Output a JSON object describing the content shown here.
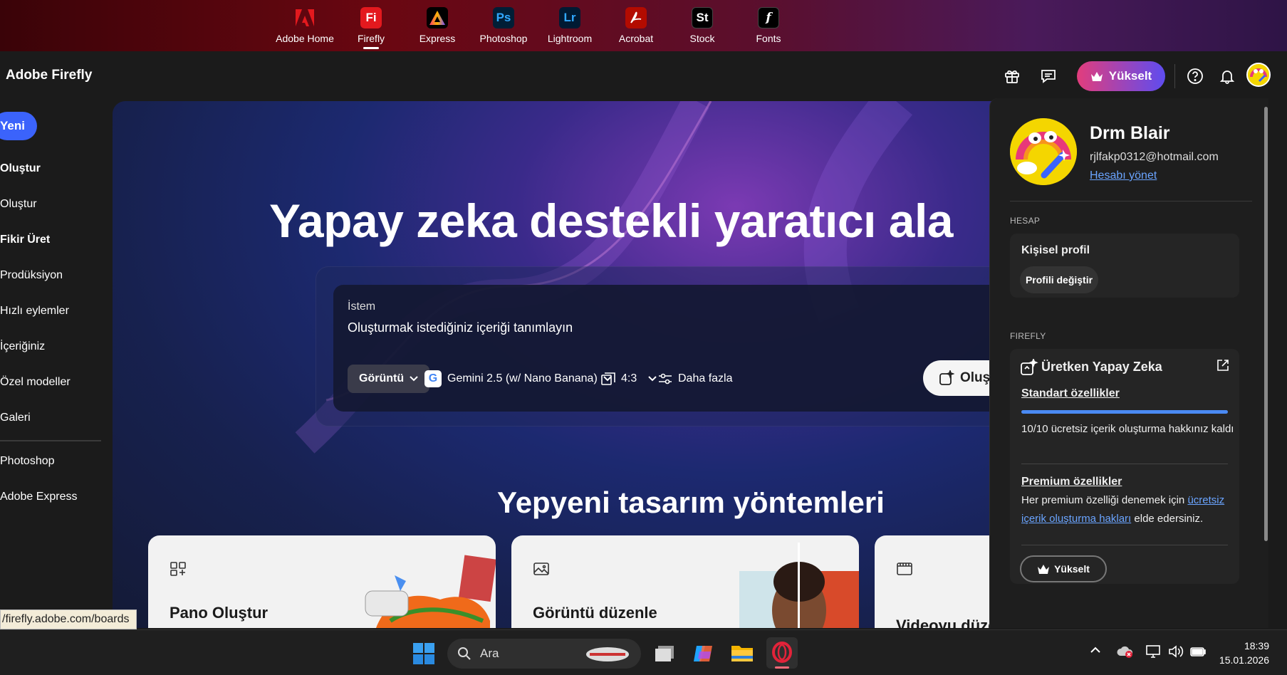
{
  "apps": [
    {
      "label": "Adobe Home",
      "glyph": "",
      "color": "#e3191e"
    },
    {
      "label": "Firefly",
      "glyph": "Fi",
      "color": "#e3191e"
    },
    {
      "label": "Express",
      "glyph": "A",
      "color": "#000000"
    },
    {
      "label": "Photoshop",
      "glyph": "Ps",
      "color": "#001e36"
    },
    {
      "label": "Lightroom",
      "glyph": "Lr",
      "color": "#001a33"
    },
    {
      "label": "Acrobat",
      "glyph": "",
      "color": "#b30b00"
    },
    {
      "label": "Stock",
      "glyph": "St",
      "color": "#000000"
    },
    {
      "label": "Fonts",
      "glyph": "f",
      "color": "#000000"
    }
  ],
  "header": {
    "brand": "Adobe Firefly",
    "upgrade_label": "Yükselt"
  },
  "sidebar": {
    "new_label": "Yeni",
    "items": [
      "Oluştur",
      "Oluştur",
      "Fikir Üret",
      "Prodüksiyon",
      "Hızlı eylemler",
      "İçeriğiniz",
      "Özel modeller",
      "Galeri",
      "Photoshop",
      "Adobe Express"
    ]
  },
  "hero": {
    "title": "Yapay zeka destekli yaratıcı ala",
    "prompt_label": "İstem",
    "prompt_placeholder": "Oluşturmak istediğiniz içeriği tanımlayın",
    "type_label": "Görüntü",
    "model_label": "Gemini 2.5 (w/ Nano Banana)",
    "ratio_label": "4:3",
    "more_label": "Daha fazla",
    "generate_label": "Oluş",
    "section_title": "Yepyeni tasarım yöntemleri",
    "cards": [
      {
        "title": "Pano Oluştur"
      },
      {
        "title": "Görüntü düzenle"
      },
      {
        "title": "Videoyu düze"
      }
    ]
  },
  "status_url": "/firefly.adobe.com/boards",
  "profile": {
    "name": "Drm Blair",
    "email": "rjlfakp0312@hotmail.com",
    "manage_link": "Hesabı yönet",
    "account_section": "HESAP",
    "personal_profile": "Kişisel profil",
    "switch_profile": "Profili değiştir",
    "firefly_section": "FIREFLY",
    "genai_title": "Üretken Yapay Zeka",
    "standard_link": "Standart özellikler",
    "credits_progress": 1.0,
    "credits_text": "10/10 ücretsiz içerik oluşturma hakkınız kaldı",
    "premium_link": "Premium özellikler",
    "premium_text_1": "Her premium özelliği denemek için",
    "premium_text_link": "ücretsiz içerik oluşturma hakları",
    "premium_text_2": "elde edersiniz.",
    "upgrade_label": "Yükselt"
  },
  "taskbar": {
    "search_label": "Ara",
    "time": "18:39",
    "date": "15.01.2026"
  }
}
